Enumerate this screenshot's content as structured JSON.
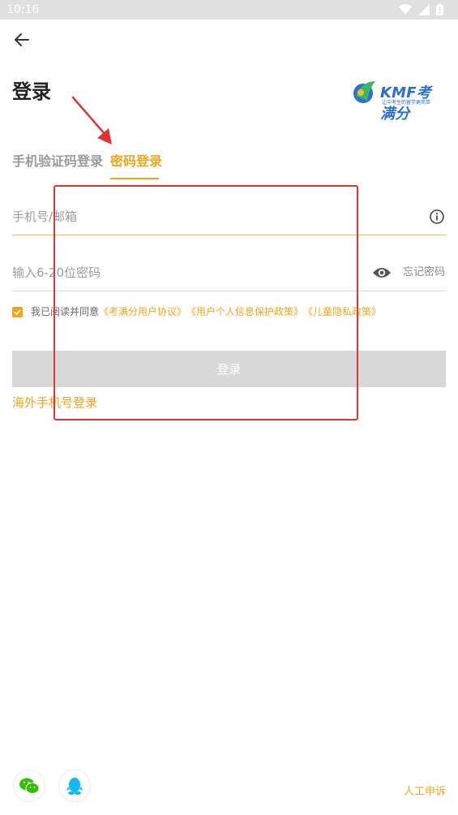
{
  "status_bar": {
    "time": "10:16"
  },
  "header": {
    "back_icon": "arrow-left-icon",
    "title": "登录"
  },
  "logo": {
    "brand": "KMF考满分",
    "tagline": "让中考生的留学更简单"
  },
  "tabs": [
    {
      "label": "手机验证码登录",
      "active": false
    },
    {
      "label": "密码登录",
      "active": true
    }
  ],
  "form": {
    "account_placeholder": "手机号/邮箱",
    "password_placeholder": "输入6-20位密码",
    "forgot_label": "忘记密码"
  },
  "agreement": {
    "checked": true,
    "prefix": "我已阅读并同意",
    "links": [
      "《考满分用户协议》",
      "《用户个人信息保护政策》",
      "《儿童隐私政策》"
    ]
  },
  "login_button": "登录",
  "overseas_login": "海外手机号登录",
  "social_icons": [
    "wechat-icon",
    "qq-icon"
  ],
  "appeal_label": "人工申诉",
  "colors": {
    "accent": "#f2a51a",
    "annotation": "#e23333",
    "disabled_button": "#d8d8d8"
  }
}
